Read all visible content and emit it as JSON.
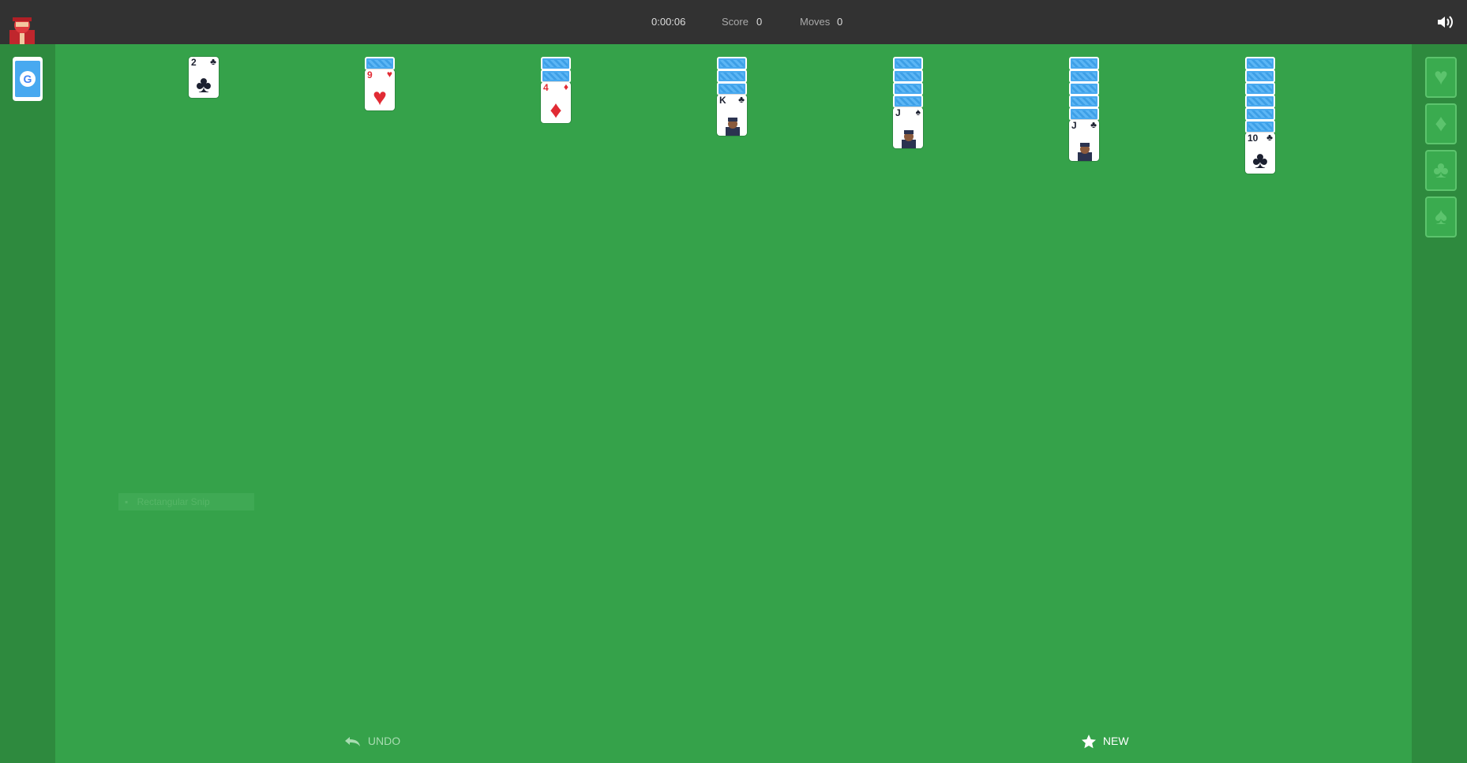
{
  "header": {
    "timer": "0:00:06",
    "score_label": "Score",
    "score_value": "0",
    "moves_label": "Moves",
    "moves_value": "0"
  },
  "icons": {
    "logo": "solitaire-character-icon",
    "sound": "speaker-icon",
    "undo": "undo-arrow-icon",
    "new": "star-icon",
    "stock": "google-g-icon"
  },
  "colors": {
    "table_green": "#35a24a",
    "rail_green": "#2e8a3e",
    "topbar": "#323232",
    "card_back_blue": "#48a9f0",
    "red_suit": "#e12b34",
    "black_suit": "#1c2030"
  },
  "tableau": [
    {
      "hidden": 0,
      "rank": "2",
      "suit": "♣",
      "color": "black"
    },
    {
      "hidden": 1,
      "rank": "9",
      "suit": "♥",
      "color": "red"
    },
    {
      "hidden": 2,
      "rank": "4",
      "suit": "♦",
      "color": "red"
    },
    {
      "hidden": 3,
      "rank": "K",
      "suit": "♣",
      "color": "black"
    },
    {
      "hidden": 4,
      "rank": "J",
      "suit": "♠",
      "color": "black"
    },
    {
      "hidden": 5,
      "rank": "J",
      "suit": "♣",
      "color": "black"
    },
    {
      "hidden": 6,
      "rank": "10",
      "suit": "♣",
      "color": "black"
    }
  ],
  "foundations": [
    "♥",
    "♦",
    "♣",
    "♠"
  ],
  "snip_text": "Rectangular Snip",
  "buttons": {
    "undo_label": "UNDO",
    "new_label": "NEW"
  }
}
